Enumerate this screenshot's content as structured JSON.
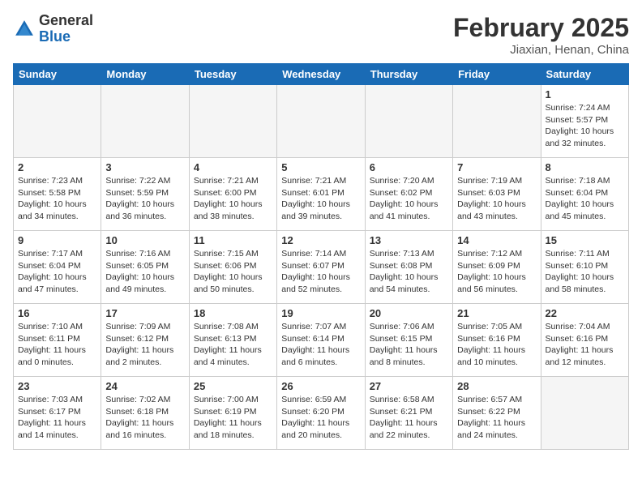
{
  "header": {
    "logo_general": "General",
    "logo_blue": "Blue",
    "title": "February 2025",
    "subtitle": "Jiaxian, Henan, China"
  },
  "weekdays": [
    "Sunday",
    "Monday",
    "Tuesday",
    "Wednesday",
    "Thursday",
    "Friday",
    "Saturday"
  ],
  "weeks": [
    [
      {
        "day": "",
        "info": ""
      },
      {
        "day": "",
        "info": ""
      },
      {
        "day": "",
        "info": ""
      },
      {
        "day": "",
        "info": ""
      },
      {
        "day": "",
        "info": ""
      },
      {
        "day": "",
        "info": ""
      },
      {
        "day": "1",
        "info": "Sunrise: 7:24 AM\nSunset: 5:57 PM\nDaylight: 10 hours and 32 minutes."
      }
    ],
    [
      {
        "day": "2",
        "info": "Sunrise: 7:23 AM\nSunset: 5:58 PM\nDaylight: 10 hours and 34 minutes."
      },
      {
        "day": "3",
        "info": "Sunrise: 7:22 AM\nSunset: 5:59 PM\nDaylight: 10 hours and 36 minutes."
      },
      {
        "day": "4",
        "info": "Sunrise: 7:21 AM\nSunset: 6:00 PM\nDaylight: 10 hours and 38 minutes."
      },
      {
        "day": "5",
        "info": "Sunrise: 7:21 AM\nSunset: 6:01 PM\nDaylight: 10 hours and 39 minutes."
      },
      {
        "day": "6",
        "info": "Sunrise: 7:20 AM\nSunset: 6:02 PM\nDaylight: 10 hours and 41 minutes."
      },
      {
        "day": "7",
        "info": "Sunrise: 7:19 AM\nSunset: 6:03 PM\nDaylight: 10 hours and 43 minutes."
      },
      {
        "day": "8",
        "info": "Sunrise: 7:18 AM\nSunset: 6:04 PM\nDaylight: 10 hours and 45 minutes."
      }
    ],
    [
      {
        "day": "9",
        "info": "Sunrise: 7:17 AM\nSunset: 6:04 PM\nDaylight: 10 hours and 47 minutes."
      },
      {
        "day": "10",
        "info": "Sunrise: 7:16 AM\nSunset: 6:05 PM\nDaylight: 10 hours and 49 minutes."
      },
      {
        "day": "11",
        "info": "Sunrise: 7:15 AM\nSunset: 6:06 PM\nDaylight: 10 hours and 50 minutes."
      },
      {
        "day": "12",
        "info": "Sunrise: 7:14 AM\nSunset: 6:07 PM\nDaylight: 10 hours and 52 minutes."
      },
      {
        "day": "13",
        "info": "Sunrise: 7:13 AM\nSunset: 6:08 PM\nDaylight: 10 hours and 54 minutes."
      },
      {
        "day": "14",
        "info": "Sunrise: 7:12 AM\nSunset: 6:09 PM\nDaylight: 10 hours and 56 minutes."
      },
      {
        "day": "15",
        "info": "Sunrise: 7:11 AM\nSunset: 6:10 PM\nDaylight: 10 hours and 58 minutes."
      }
    ],
    [
      {
        "day": "16",
        "info": "Sunrise: 7:10 AM\nSunset: 6:11 PM\nDaylight: 11 hours and 0 minutes."
      },
      {
        "day": "17",
        "info": "Sunrise: 7:09 AM\nSunset: 6:12 PM\nDaylight: 11 hours and 2 minutes."
      },
      {
        "day": "18",
        "info": "Sunrise: 7:08 AM\nSunset: 6:13 PM\nDaylight: 11 hours and 4 minutes."
      },
      {
        "day": "19",
        "info": "Sunrise: 7:07 AM\nSunset: 6:14 PM\nDaylight: 11 hours and 6 minutes."
      },
      {
        "day": "20",
        "info": "Sunrise: 7:06 AM\nSunset: 6:15 PM\nDaylight: 11 hours and 8 minutes."
      },
      {
        "day": "21",
        "info": "Sunrise: 7:05 AM\nSunset: 6:16 PM\nDaylight: 11 hours and 10 minutes."
      },
      {
        "day": "22",
        "info": "Sunrise: 7:04 AM\nSunset: 6:16 PM\nDaylight: 11 hours and 12 minutes."
      }
    ],
    [
      {
        "day": "23",
        "info": "Sunrise: 7:03 AM\nSunset: 6:17 PM\nDaylight: 11 hours and 14 minutes."
      },
      {
        "day": "24",
        "info": "Sunrise: 7:02 AM\nSunset: 6:18 PM\nDaylight: 11 hours and 16 minutes."
      },
      {
        "day": "25",
        "info": "Sunrise: 7:00 AM\nSunset: 6:19 PM\nDaylight: 11 hours and 18 minutes."
      },
      {
        "day": "26",
        "info": "Sunrise: 6:59 AM\nSunset: 6:20 PM\nDaylight: 11 hours and 20 minutes."
      },
      {
        "day": "27",
        "info": "Sunrise: 6:58 AM\nSunset: 6:21 PM\nDaylight: 11 hours and 22 minutes."
      },
      {
        "day": "28",
        "info": "Sunrise: 6:57 AM\nSunset: 6:22 PM\nDaylight: 11 hours and 24 minutes."
      },
      {
        "day": "",
        "info": ""
      }
    ]
  ]
}
